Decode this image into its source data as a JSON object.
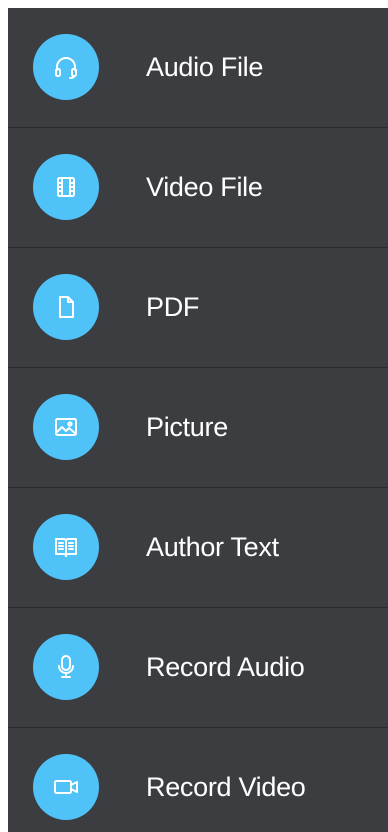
{
  "menu": {
    "items": [
      {
        "label": "Audio File",
        "icon": "headphones-icon"
      },
      {
        "label": "Video File",
        "icon": "film-icon"
      },
      {
        "label": "PDF",
        "icon": "document-icon"
      },
      {
        "label": "Picture",
        "icon": "image-icon"
      },
      {
        "label": "Author Text",
        "icon": "book-icon"
      },
      {
        "label": "Record Audio",
        "icon": "microphone-icon"
      },
      {
        "label": "Record Video",
        "icon": "video-camera-icon"
      }
    ]
  },
  "colors": {
    "background": "#3b3d41",
    "accent": "#4fc3f7",
    "divider": "#2a2b2e",
    "text": "#ffffff"
  }
}
